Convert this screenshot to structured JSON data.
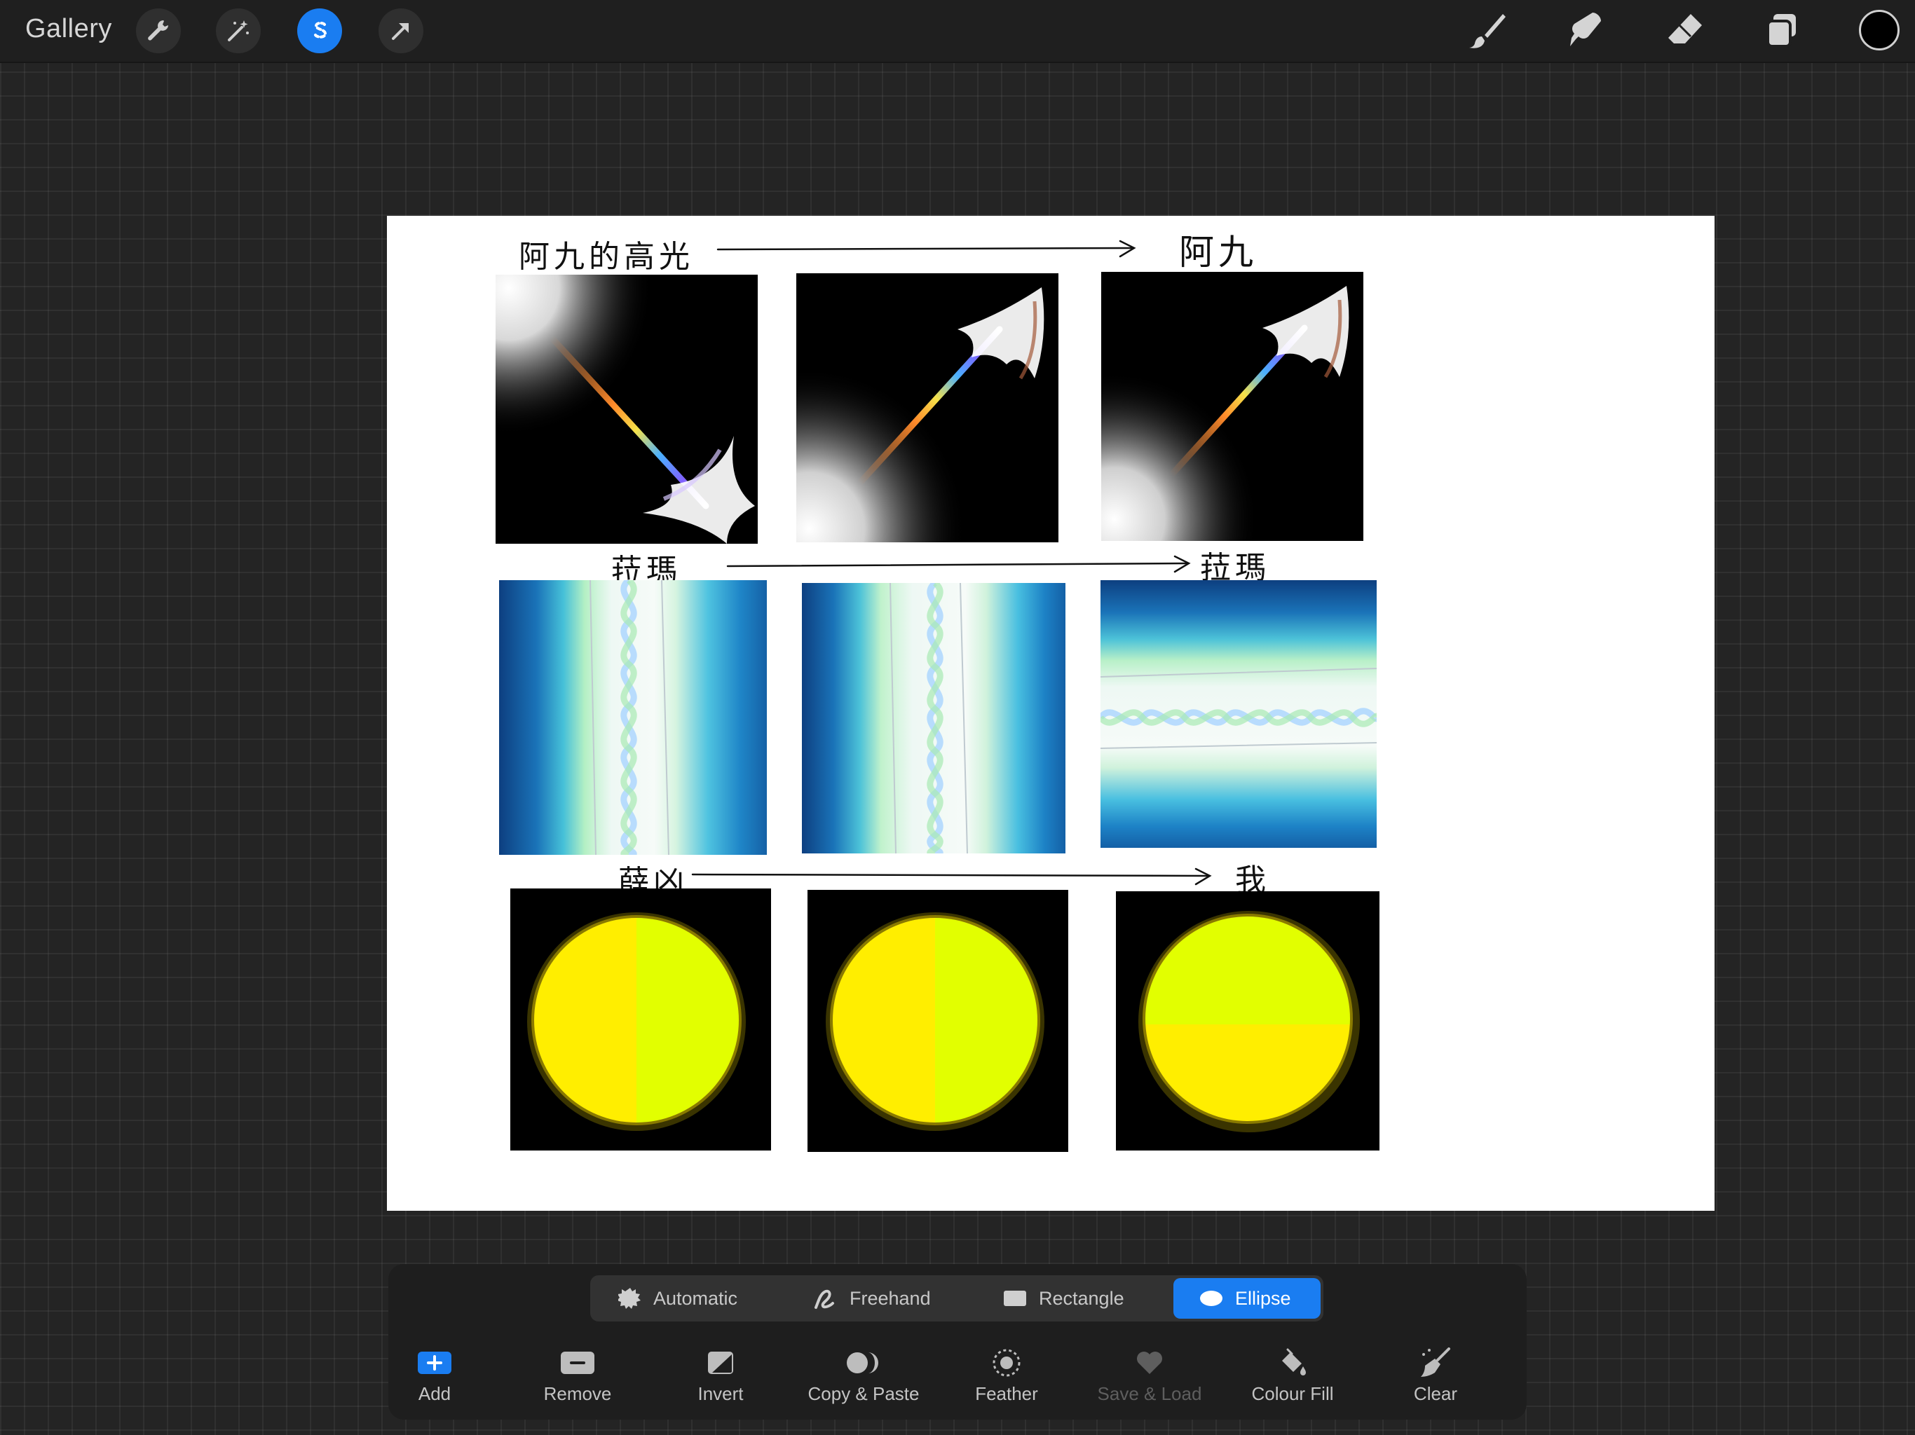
{
  "toolbar": {
    "gallery_label": "Gallery",
    "accent": "#1a7df1",
    "left_tools": [
      "wrench-icon",
      "magic-wand-icon",
      "selection-icon",
      "transform-arrow-icon"
    ],
    "right_tools": [
      "brush-icon",
      "smudge-icon",
      "eraser-icon",
      "layers-icon"
    ],
    "current_color": "#000000"
  },
  "canvas": {
    "row1": {
      "left_note": "阿九的高光",
      "right_note": "阿九"
    },
    "row2": {
      "left_note": "菈瑪",
      "right_note": "菈瑪"
    },
    "row3": {
      "left_note": "薛凶",
      "right_note": "我"
    }
  },
  "selection": {
    "modes": [
      {
        "label": "Automatic",
        "icon": "automatic-icon"
      },
      {
        "label": "Freehand",
        "icon": "freehand-icon"
      },
      {
        "label": "Rectangle",
        "icon": "rectangle-icon"
      },
      {
        "label": "Ellipse",
        "icon": "ellipse-icon",
        "active": true
      }
    ],
    "actions": [
      {
        "label": "Add",
        "icon": "add-icon"
      },
      {
        "label": "Remove",
        "icon": "remove-icon"
      },
      {
        "label": "Invert",
        "icon": "invert-icon"
      },
      {
        "label": "Copy & Paste",
        "icon": "copy-paste-icon"
      },
      {
        "label": "Feather",
        "icon": "feather-icon"
      },
      {
        "label": "Save & Load",
        "icon": "save-load-icon",
        "disabled": true
      },
      {
        "label": "Colour Fill",
        "icon": "colour-fill-icon"
      },
      {
        "label": "Clear",
        "icon": "clear-icon"
      }
    ]
  }
}
